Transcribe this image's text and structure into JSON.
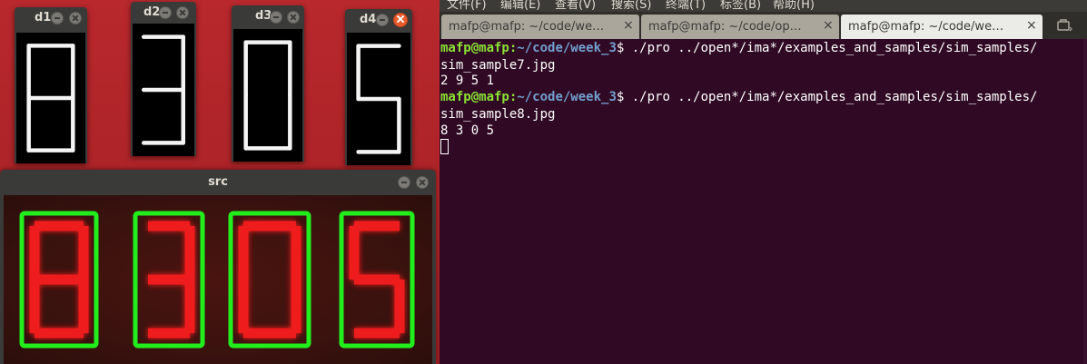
{
  "digit_windows": [
    {
      "title": "d1",
      "glyph": "8"
    },
    {
      "title": "d2",
      "glyph": "3"
    },
    {
      "title": "d3",
      "glyph": "0"
    },
    {
      "title": "d4",
      "glyph": "5"
    }
  ],
  "src_window": {
    "title": "src",
    "digits": [
      "8",
      "3",
      "0",
      "5"
    ]
  },
  "terminal": {
    "menu": [
      "文件(F)",
      "编辑(E)",
      "查看(V)",
      "搜索(S)",
      "终端(T)",
      "标签(B)",
      "帮助(H)"
    ],
    "tabs": [
      {
        "title": "mafp@mafp: ~/code/we…",
        "close": "×"
      },
      {
        "title": "mafp@mafp: ~/code/op…",
        "close": "×"
      },
      {
        "title": "mafp@mafp: ~/code/we…",
        "close": "×"
      }
    ],
    "prompt_user": "mafp@mafp",
    "prompt_path": "~/code/week_3",
    "lines": [
      {
        "cmd": "$ ./pro ../open*/ima*/examples_and_samples/sim_samples/"
      },
      {
        "text": "sim_sample7.jpg"
      },
      {
        "text": "2 9 5 1"
      },
      {
        "cmd": "$ ./pro ../open*/ima*/examples_and_samples/sim_samples/"
      },
      {
        "text": "sim_sample8.jpg"
      },
      {
        "text": "8 3 0 5"
      }
    ]
  },
  "colors": {
    "desktop": "#b3262b",
    "terminal_bg": "#300a24",
    "prompt_user": "#8ae234",
    "prompt_path": "#729fcf",
    "segment": "#ee1a1a",
    "box": "#22ee1e"
  }
}
